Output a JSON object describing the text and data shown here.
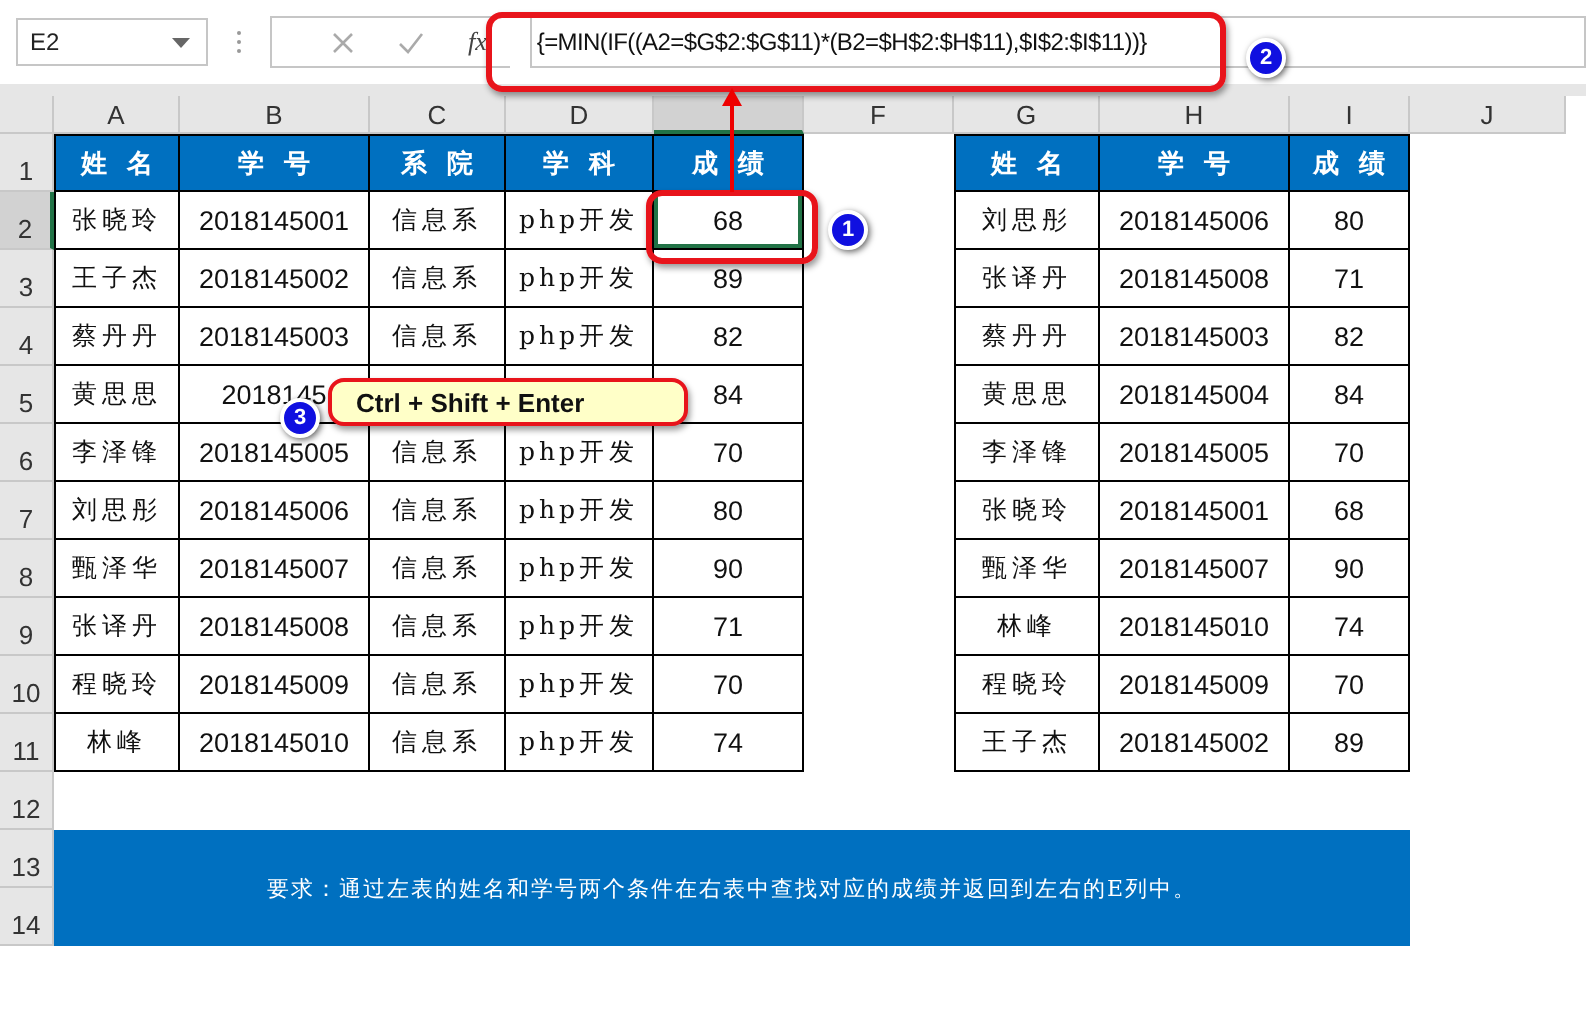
{
  "name_box": "E2",
  "fx_label": "fx",
  "formula": "{=MIN(IF((A2=$G$2:$G$11)*(B2=$H$2:$H$11),$I$2:$I$11))}",
  "columns": [
    {
      "label": "A",
      "selected": false
    },
    {
      "label": "B",
      "selected": false
    },
    {
      "label": "C",
      "selected": false
    },
    {
      "label": "D",
      "selected": false
    },
    {
      "selected": true
    },
    {
      "label": "F",
      "selected": false
    },
    {
      "label": "G",
      "selected": false
    },
    {
      "label": "H",
      "selected": false
    },
    {
      "label": "I",
      "selected": false
    },
    {
      "label": "J",
      "selected": false
    }
  ],
  "rows": [
    {
      "label": "1",
      "selected": false
    },
    {
      "label": "2",
      "selected": true
    },
    {
      "label": "3",
      "selected": false
    },
    {
      "label": "4",
      "selected": false
    },
    {
      "label": "5",
      "selected": false
    },
    {
      "label": "6",
      "selected": false
    },
    {
      "label": "7",
      "selected": false
    },
    {
      "label": "8",
      "selected": false
    },
    {
      "label": "9",
      "selected": false
    },
    {
      "label": "10",
      "selected": false
    },
    {
      "label": "11",
      "selected": false
    },
    {
      "label": "12",
      "selected": false
    },
    {
      "label": "13",
      "selected": false
    },
    {
      "label": "14",
      "selected": false
    }
  ],
  "left_table": {
    "columns": [
      "姓名",
      "学号",
      "系院",
      "学科",
      "成绩"
    ],
    "rows": [
      [
        "张晓玲",
        "2018145001",
        "信息系",
        "php开发",
        "68"
      ],
      [
        "王子杰",
        "2018145002",
        "信息系",
        "php开发",
        "89"
      ],
      [
        "蔡丹丹",
        "2018145003",
        "信息系",
        "php开发",
        "82"
      ],
      [
        "黄思思",
        "2018145",
        null,
        null,
        "84"
      ],
      [
        "李泽锋",
        "2018145005",
        "信息系",
        "php开发",
        "70"
      ],
      [
        "刘思彤",
        "2018145006",
        "信息系",
        "php开发",
        "80"
      ],
      [
        "甄泽华",
        "2018145007",
        "信息系",
        "php开发",
        "90"
      ],
      [
        "张译丹",
        "2018145008",
        "信息系",
        "php开发",
        "71"
      ],
      [
        "程晓玲",
        "2018145009",
        "信息系",
        "php开发",
        "70"
      ],
      [
        "林峰",
        "2018145010",
        "信息系",
        "php开发",
        "74"
      ]
    ]
  },
  "right_table": {
    "columns": [
      "姓名",
      "学号",
      "成绩"
    ],
    "rows": [
      [
        "刘思彤",
        "2018145006",
        "80"
      ],
      [
        "张译丹",
        "2018145008",
        "71"
      ],
      [
        "蔡丹丹",
        "2018145003",
        "82"
      ],
      [
        "黄思思",
        "2018145004",
        "84"
      ],
      [
        "李泽锋",
        "2018145005",
        "70"
      ],
      [
        "张晓玲",
        "2018145001",
        "68"
      ],
      [
        "甄泽华",
        "2018145007",
        "90"
      ],
      [
        "林峰",
        "2018145010",
        "74"
      ],
      [
        "程晓玲",
        "2018145009",
        "70"
      ],
      [
        "王子杰",
        "2018145002",
        "89"
      ]
    ]
  },
  "banner": "要求：通过左表的姓名和学号两个条件在右表中查找对应的成绩并返回到左右的E列中。",
  "callouts": {
    "badges": [
      "1",
      "2",
      "3"
    ],
    "shortcut": "Ctrl + Shift + Enter"
  }
}
